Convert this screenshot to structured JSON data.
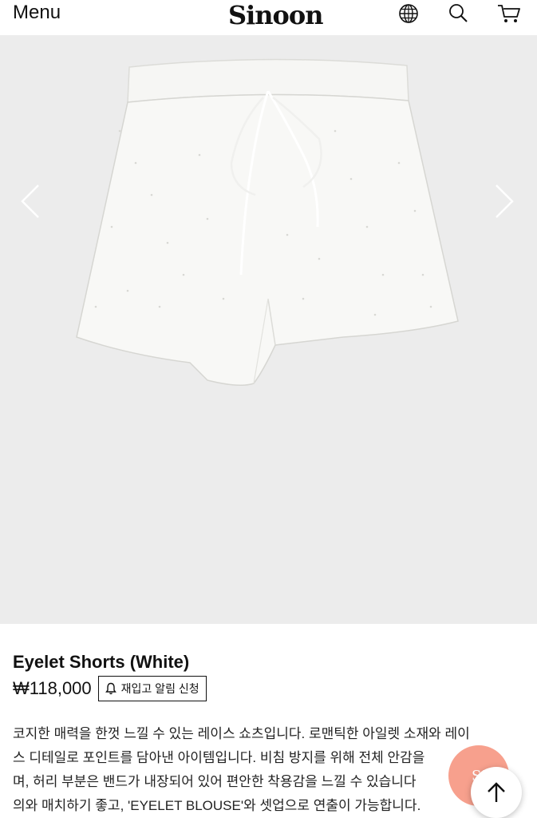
{
  "header": {
    "menu_label": "Menu",
    "logo_text": "Sinoon",
    "icons": [
      "globe-icon",
      "search-icon",
      "cart-icon"
    ]
  },
  "product": {
    "image_alt": "Eyelet Shorts (White)",
    "name": "Eyelet Shorts (White)",
    "price": "₩118,000",
    "notify_label": "재입고 알림 신청",
    "description_lines": [
      "코지한 매력을 한껏 느낄 수 있는 레이스 쇼츠입니다. 로맨틱한 아일렛 소재와 레이",
      "스 디테일로 포인트를 담아낸 아이템입니다. 비침 방지를 위해 전체 안감을",
      "며, 허리 부분은 밴드가 내장되어 있어 편안한 착용감을 느낄 수 있습니다",
      "의와 매치하기 좋고, 'EYELET BLOUSE'와 셋업으로 연출이 가능합니다."
    ]
  },
  "floating": {
    "chat_label": "Si",
    "top_icon": "arrow-up-icon"
  },
  "colors": {
    "hero_bg": "#ececec",
    "chat_fab": "#f7a08d"
  }
}
